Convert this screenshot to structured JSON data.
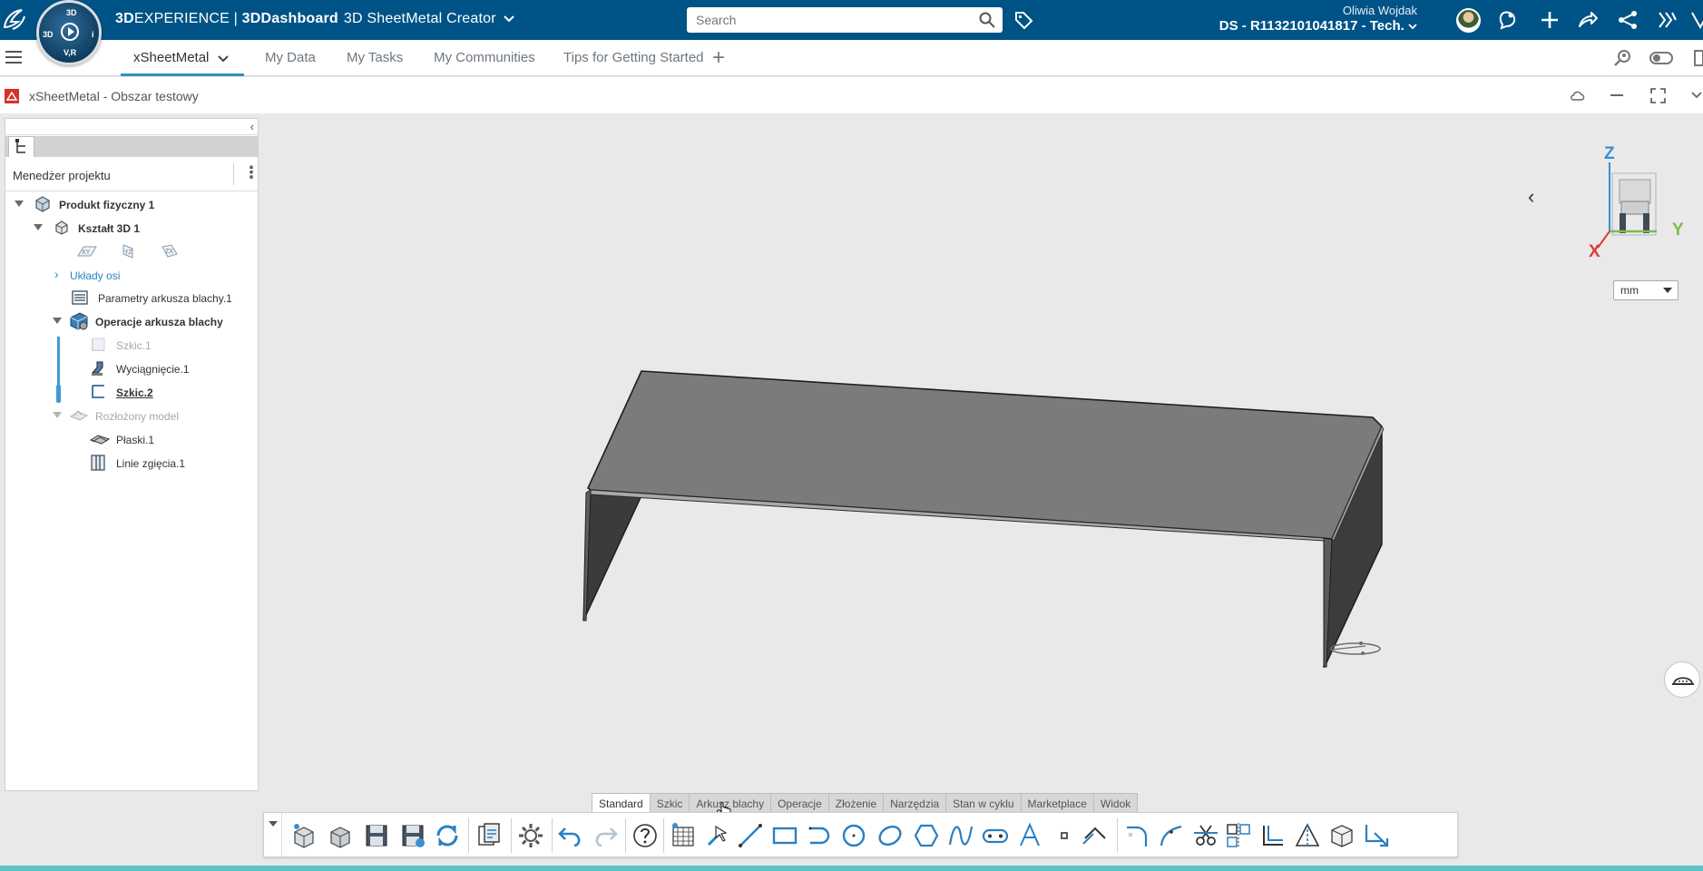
{
  "header": {
    "brand_bold": "3D",
    "brand_rest": "EXPERIENCE",
    "brand_sep": " | ",
    "dashboard_bold": "3D",
    "dashboard_rest": "Dashboard",
    "app_name": "3D SheetMetal Creator",
    "search_placeholder": "Search",
    "user_name": "Oliwia Wojdak",
    "tenant": "DS - R1132101041817 - Tech.",
    "compass_top": "3D",
    "compass_bottom": "V,R",
    "compass_left": "3D",
    "compass_right": "i"
  },
  "tabs": [
    {
      "label": "xSheetMetal",
      "active": true
    },
    {
      "label": "My Data"
    },
    {
      "label": "My Tasks"
    },
    {
      "label": "My Communities"
    },
    {
      "label": "Tips for Getting Started"
    }
  ],
  "widget": {
    "title": "xSheetMetal - Obszar testowy"
  },
  "panel": {
    "manager_label": "Menedżer projektu",
    "tree": [
      {
        "label": "Produkt fizyczny 1",
        "style": "bold"
      },
      {
        "label": "Kształt 3D 1",
        "style": "bold"
      },
      {
        "label": "Układy osi",
        "style": "blue"
      },
      {
        "label": "Parametry arkusza blachy.1",
        "style": "normal"
      },
      {
        "label": "Operacje arkusza blachy",
        "style": "bold"
      },
      {
        "label": "Szkic.1",
        "style": "grey"
      },
      {
        "label": "Wyciągnięcie.1",
        "style": "normal"
      },
      {
        "label": "Szkic.2",
        "style": "current"
      },
      {
        "label": "Rozłożony model",
        "style": "grey"
      },
      {
        "label": "Płaski.1",
        "style": "normal"
      },
      {
        "label": "Linie zgięcia.1",
        "style": "normal"
      }
    ],
    "planes": [
      "XY",
      "YZ",
      "ZX"
    ]
  },
  "viewport": {
    "axis_x": "X",
    "axis_y": "Y",
    "axis_z": "Z",
    "unit": "mm"
  },
  "action_bar": {
    "sections": [
      "Standard",
      "Szkic",
      "Arkusz blachy",
      "Operacje",
      "Złożenie",
      "Narzędzia",
      "Stan w cyklu",
      "Marketplace",
      "Widok"
    ],
    "active_section": "Standard"
  },
  "colors": {
    "top_bar": "#005386",
    "accent": "#368ec4",
    "teal": "#5ec3c9",
    "part": "#7b7b7b"
  }
}
